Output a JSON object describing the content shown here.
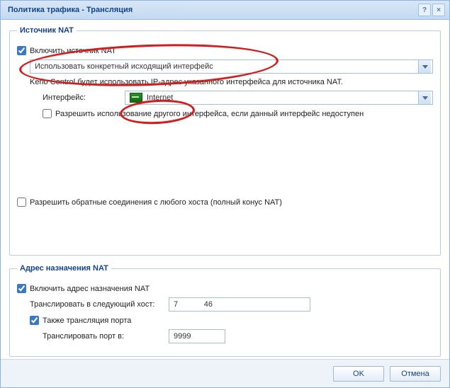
{
  "title": "Политика трафика - Трансляция",
  "titlebar": {
    "help": "?",
    "close": "×"
  },
  "sourceNat": {
    "legend": "Источник NAT",
    "enable_label": "Включить источник NAT",
    "enable_checked": true,
    "mode_value": "Использовать конкретный исходящий интерфейс",
    "description": "Kerio Control будет использовать IP-адрес указанного интерфейса для источника NAT.",
    "iface_label": "Интерфейс:",
    "iface_value": "Internet",
    "allow_other_label": "Разрешить использование другого интерфейса, если данный интерфейс недоступен",
    "allow_other_checked": false,
    "reverse_label": "Разрешить обратные соединения с любого хоста (полный конус NAT)",
    "reverse_checked": false
  },
  "destNat": {
    "legend": "Адрес назначения NAT",
    "enable_label": "Включить адрес назначения NAT",
    "enable_checked": true,
    "host_label": "Транслировать в следующий хост:",
    "host_value": "7            46",
    "port_translate_label": "Также трансляция порта",
    "port_translate_checked": true,
    "port_label": "Транслировать порт в:",
    "port_value": "9999"
  },
  "buttons": {
    "ok": "OK",
    "cancel": "Отмена"
  }
}
